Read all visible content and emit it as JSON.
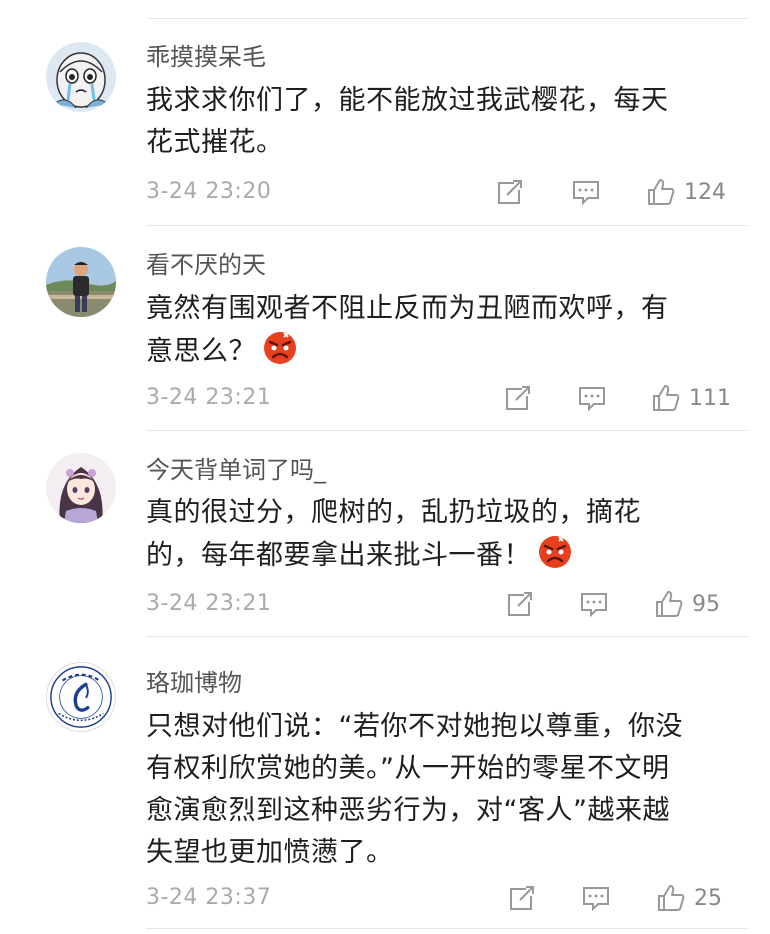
{
  "comments": [
    {
      "username": "乖摸摸呆毛",
      "lines": [
        "我求求你们了，能不能放过我武樱花，每天",
        "花式摧花。"
      ],
      "emoji": null,
      "time": "3-24 23:20",
      "likes": "124",
      "avatar_icon": "cartoon-crying-face-avatar"
    },
    {
      "username": "看不厌的天",
      "lines": [
        "竟然有围观者不阻止反而为丑陋而欢呼，有",
        "意思么？"
      ],
      "emoji": "angry-face-emoji",
      "time": "3-24 23:21",
      "likes": "111",
      "avatar_icon": "person-outdoor-photo-avatar"
    },
    {
      "username": "今天背单词了吗_",
      "lines": [
        "真的很过分，爬树的，乱扔垃圾的，摘花",
        "的，每年都要拿出来批斗一番！"
      ],
      "emoji": "angry-face-emoji",
      "time": "3-24 23:21",
      "likes": "95",
      "avatar_icon": "anime-girl-avatar"
    },
    {
      "username": "珞珈博物",
      "lines": [
        "只想对他们说：“若你不对她抱以尊重，你没",
        "有权利欣赏她的美。”从一开始的零星不文明",
        "愈演愈烈到这种恶劣行为，对“客人”越来越",
        "失望也更加愤懑了。"
      ],
      "emoji": null,
      "time": "3-24 23:37",
      "likes": "25",
      "avatar_icon": "museum-seal-logo-avatar"
    }
  ],
  "icons": {
    "repost": "repost-icon",
    "comment": "comment-icon",
    "like": "thumbs-up-icon"
  },
  "colors": {
    "angry_emoji": "#e8401e",
    "meta_text": "#aaaaaa",
    "seal_blue": "#1d3f8f"
  }
}
